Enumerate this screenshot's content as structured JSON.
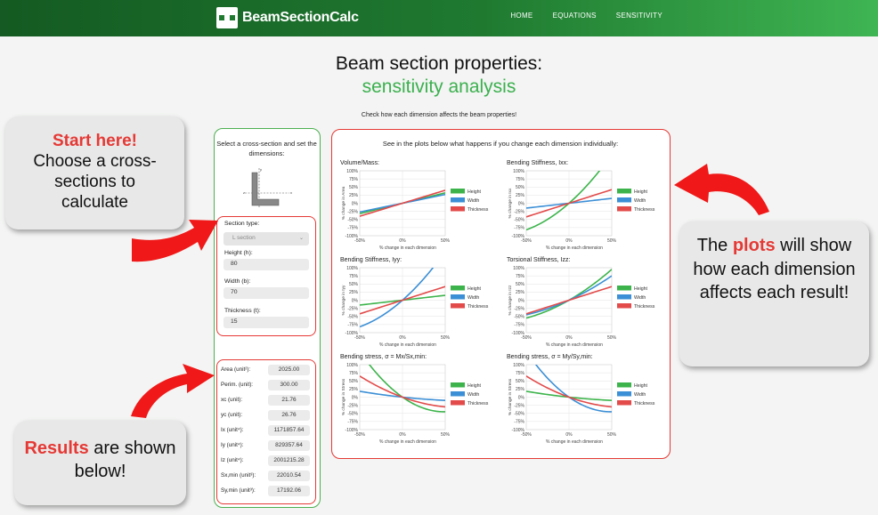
{
  "nav": {
    "brand": "BeamSectionCalc",
    "links": [
      "HOME",
      "EQUATIONS",
      "SENSITIVITY"
    ]
  },
  "page": {
    "title": "Beam section properties:",
    "subtitle": "sensitivity analysis",
    "intro": "Check how each dimension affects the beam properties!"
  },
  "left_panel": {
    "intro": "Select a cross-section and set the dimensions:",
    "section_type_label": "Section type:",
    "section_type_value": "L section",
    "height_label": "Height (h):",
    "height_value": "80",
    "width_label": "Width (b):",
    "width_value": "70",
    "thickness_label": "Thickness (t):",
    "thickness_value": "15"
  },
  "results": [
    {
      "label": "Area (unit²):",
      "value": "2025.00"
    },
    {
      "label": "Perim. (unit):",
      "value": "300.00"
    },
    {
      "label": "xc (unit):",
      "value": "21.76"
    },
    {
      "label": "yc (unit):",
      "value": "26.76"
    },
    {
      "label": "Ix (unit⁴):",
      "value": "1171857.64"
    },
    {
      "label": "Iy (unit⁴):",
      "value": "829357.64"
    },
    {
      "label": "Iz (unit⁴):",
      "value": "2001215.28"
    },
    {
      "label": "Sx,min (unit³):",
      "value": "22010.54"
    },
    {
      "label": "Sy,min (unit³):",
      "value": "17192.06"
    }
  ],
  "plots_panel": {
    "intro": "See in the plots below what happens if you change each dimension individually:",
    "xlabel": "% change in each dimension",
    "legend": [
      "Height",
      "Width",
      "Thickness"
    ],
    "colors": {
      "height": "#3cb44b",
      "width": "#3b8fd6",
      "thickness": "#e34a4a"
    }
  },
  "chart_data": [
    {
      "type": "line",
      "title": "Volume/Mass:",
      "ylabel": "% change in Area",
      "xlabel": "% change in each dimension",
      "x": [
        -50,
        0,
        50
      ],
      "xticks": [
        "-50%",
        "0%",
        "50%"
      ],
      "ylim": [
        -100,
        100
      ],
      "yticks": [
        "100%",
        "75%",
        "50%",
        "25%",
        "0%",
        "-25%",
        "-50%",
        "-75%",
        "-100%"
      ],
      "series": [
        {
          "name": "Height",
          "values": [
            -32,
            0,
            32
          ]
        },
        {
          "name": "Width",
          "values": [
            -27,
            0,
            27
          ]
        },
        {
          "name": "Thickness",
          "values": [
            -40,
            0,
            40
          ]
        }
      ]
    },
    {
      "type": "line",
      "title": "Bending Stiffness, Ixx:",
      "ylabel": "% change in Ixx",
      "xlabel": "% change in each dimension",
      "x": [
        -50,
        0,
        50
      ],
      "xticks": [
        "-50%",
        "0%",
        "50%"
      ],
      "ylim": [
        -100,
        100
      ],
      "yticks": [
        "100%",
        "75%",
        "50%",
        "25%",
        "0%",
        "-25%",
        "-50%",
        "-75%",
        "-100%"
      ],
      "series": [
        {
          "name": "Height",
          "values": [
            -82,
            0,
            150
          ]
        },
        {
          "name": "Width",
          "values": [
            -15,
            0,
            15
          ]
        },
        {
          "name": "Thickness",
          "values": [
            -42,
            0,
            42
          ]
        }
      ]
    },
    {
      "type": "line",
      "title": "Bending Stiffness, Iyy:",
      "ylabel": "% change in Iyy",
      "xlabel": "% change in each dimension",
      "x": [
        -50,
        0,
        50
      ],
      "xticks": [
        "-50%",
        "0%",
        "50%"
      ],
      "ylim": [
        -100,
        100
      ],
      "yticks": [
        "100%",
        "75%",
        "50%",
        "25%",
        "0%",
        "-25%",
        "-50%",
        "-75%",
        "-100%"
      ],
      "series": [
        {
          "name": "Height",
          "values": [
            -15,
            0,
            15
          ]
        },
        {
          "name": "Width",
          "values": [
            -82,
            0,
            150
          ]
        },
        {
          "name": "Thickness",
          "values": [
            -42,
            0,
            42
          ]
        }
      ]
    },
    {
      "type": "line",
      "title": "Torsional Stiffness, Izz:",
      "ylabel": "% change in Izz",
      "xlabel": "% change in each dimension",
      "x": [
        -50,
        0,
        50
      ],
      "xticks": [
        "-50%",
        "0%",
        "50%"
      ],
      "ylim": [
        -100,
        100
      ],
      "yticks": [
        "100%",
        "75%",
        "50%",
        "25%",
        "0%",
        "-25%",
        "-50%",
        "-75%",
        "-100%"
      ],
      "series": [
        {
          "name": "Height",
          "values": [
            -55,
            0,
            95
          ]
        },
        {
          "name": "Width",
          "values": [
            -45,
            0,
            75
          ]
        },
        {
          "name": "Thickness",
          "values": [
            -42,
            0,
            42
          ]
        }
      ]
    },
    {
      "type": "line",
      "title": "Bending stress, σ = Mx/Sx,min:",
      "ylabel": "% change in Stress",
      "xlabel": "% change in each dimension",
      "x": [
        -50,
        0,
        50
      ],
      "xticks": [
        "-50%",
        "0%",
        "50%"
      ],
      "ylim": [
        -100,
        100
      ],
      "yticks": [
        "100%",
        "75%",
        "50%",
        "25%",
        "0%",
        "-25%",
        "-50%",
        "-75%",
        "-100%"
      ],
      "series": [
        {
          "name": "Height",
          "values": [
            140,
            0,
            -45
          ]
        },
        {
          "name": "Width",
          "values": [
            18,
            0,
            -10
          ]
        },
        {
          "name": "Thickness",
          "values": [
            65,
            0,
            -30
          ]
        }
      ]
    },
    {
      "type": "line",
      "title": "Bending stress, σ = My/Sy,min:",
      "ylabel": "% change in Stress",
      "xlabel": "% change in each dimension",
      "x": [
        -50,
        0,
        50
      ],
      "xticks": [
        "-50%",
        "0%",
        "50%"
      ],
      "ylim": [
        -100,
        100
      ],
      "yticks": [
        "100%",
        "75%",
        "50%",
        "25%",
        "0%",
        "-25%",
        "-50%",
        "-75%",
        "-100%"
      ],
      "series": [
        {
          "name": "Height",
          "values": [
            18,
            0,
            -10
          ]
        },
        {
          "name": "Width",
          "values": [
            140,
            0,
            -45
          ]
        },
        {
          "name": "Thickness",
          "values": [
            65,
            0,
            -30
          ]
        }
      ]
    }
  ],
  "callouts": {
    "start_highlight": "Start here!",
    "start_text": "Choose a cross-sections to calculate",
    "plots_pre": "The ",
    "plots_highlight": "plots",
    "plots_post": " will show how each dimension affects each result!",
    "results_highlight": "Results",
    "results_post": " are shown below!"
  }
}
